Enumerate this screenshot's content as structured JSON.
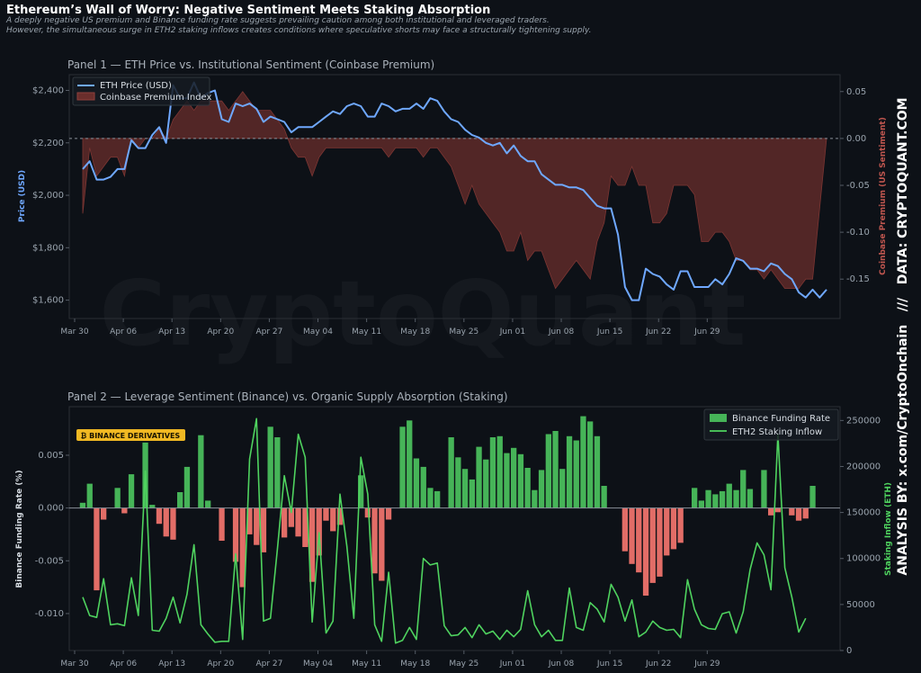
{
  "header": {
    "title": "Ethereum’s Wall of Worry: Negative Sentiment Meets Staking Absorption",
    "subtitle_1": "A deeply negative US premium and Binance funding rate suggests prevailing caution among both institutional and leveraged traders.",
    "subtitle_2": "However, the simultaneous surge in ETH2 staking inflows creates conditions where speculative shorts may face a structurally tightening supply."
  },
  "side_text": {
    "analysis": "ANALYSIS BY: x.com/CryptoOnchain",
    "separator": "///",
    "data": "DATA: CRYPTOQUANT.COM"
  },
  "watermark": "CryptoQuant",
  "colors": {
    "background": "#0d1117",
    "price": "#6fa8ff",
    "premium": "#6a2e2c",
    "funding_pos": "#46b458",
    "funding_neg": "#e26d67",
    "staking": "#4fd35f",
    "badge": "#f0b823"
  },
  "chart_data": [
    {
      "type": "line",
      "title": "Panel 1 — ETH Price vs. Institutional Sentiment (Coinbase Premium)",
      "ylabel": "Price (USD)",
      "y2label": "Coinbase Premium (US Sentiment)",
      "ylim": [
        1530,
        2460
      ],
      "y2lim": [
        -0.192,
        0.068
      ],
      "y_ticks": [
        "$1,600",
        "$1,800",
        "$2,000",
        "$2,200",
        "$2,400"
      ],
      "y2_ticks": [
        "0.05",
        "0.00",
        "-0.05",
        "-0.10",
        "-0.15"
      ],
      "x_ticks": [
        "Mar 30",
        "Apr 06",
        "Apr 13",
        "Apr 20",
        "Apr 27",
        "May 04",
        "May 11",
        "May 18",
        "May 25",
        "Jun 01",
        "Jun 08",
        "Jun 15",
        "Jun 22",
        "Jun 29"
      ],
      "legend": [
        "ETH Price (USD)",
        "Coinbase Premium Index"
      ],
      "legend_position": "top-left",
      "zero_line": 0,
      "x_start": "Mar 31",
      "x_step_days": 1,
      "series": [
        {
          "name": "ETH Price (USD)",
          "axis": "left",
          "values": [
            2100,
            2130,
            2060,
            2060,
            2070,
            2100,
            2100,
            2210,
            2180,
            2180,
            2230,
            2260,
            2200,
            2420,
            2370,
            2370,
            2430,
            2370,
            2390,
            2400,
            2290,
            2280,
            2350,
            2340,
            2350,
            2330,
            2280,
            2300,
            2290,
            2280,
            2240,
            2260,
            2260,
            2260,
            2280,
            2300,
            2320,
            2310,
            2340,
            2350,
            2340,
            2300,
            2300,
            2350,
            2340,
            2320,
            2330,
            2330,
            2350,
            2330,
            2370,
            2360,
            2320,
            2290,
            2280,
            2250,
            2230,
            2220,
            2200,
            2190,
            2200,
            2160,
            2190,
            2150,
            2130,
            2130,
            2080,
            2060,
            2040,
            2040,
            2030,
            2030,
            2020,
            1990,
            1960,
            1950,
            1950,
            1850,
            1650,
            1600,
            1600,
            1720,
            1700,
            1690,
            1660,
            1640,
            1710,
            1710,
            1650,
            1650,
            1650,
            1680,
            1660,
            1700,
            1760,
            1750,
            1720,
            1720,
            1710,
            1740,
            1730,
            1700,
            1680,
            1630,
            1610,
            1640,
            1610,
            1640
          ],
          "_note": "one value per day starting at x_start"
        },
        {
          "name": "Coinbase Premium Index",
          "axis": "right",
          "values": [
            -0.08,
            -0.01,
            -0.04,
            -0.03,
            -0.02,
            -0.02,
            -0.04,
            0.0,
            -0.01,
            0.0,
            0.0,
            0.01,
            0.0,
            0.02,
            0.03,
            0.04,
            0.03,
            0.04,
            0.04,
            0.04,
            0.04,
            0.03,
            0.04,
            0.05,
            0.04,
            0.03,
            0.03,
            0.03,
            0.02,
            0.01,
            -0.01,
            -0.02,
            -0.02,
            -0.04,
            -0.02,
            -0.01,
            -0.01,
            -0.01,
            -0.01,
            -0.01,
            -0.01,
            -0.01,
            -0.01,
            -0.01,
            -0.02,
            -0.01,
            -0.01,
            -0.01,
            -0.01,
            -0.02,
            -0.01,
            -0.01,
            -0.02,
            -0.03,
            -0.05,
            -0.07,
            -0.05,
            -0.07,
            -0.08,
            -0.09,
            -0.1,
            -0.12,
            -0.12,
            -0.1,
            -0.13,
            -0.12,
            -0.12,
            -0.14,
            -0.16,
            -0.15,
            -0.14,
            -0.13,
            -0.14,
            -0.15,
            -0.11,
            -0.09,
            -0.04,
            -0.05,
            -0.05,
            -0.03,
            -0.05,
            -0.05,
            -0.09,
            -0.09,
            -0.08,
            -0.05,
            -0.05,
            -0.05,
            -0.06,
            -0.11,
            -0.11,
            -0.1,
            -0.1,
            -0.11,
            -0.13,
            -0.13,
            -0.14,
            -0.14,
            -0.15,
            -0.14,
            -0.15,
            -0.16,
            -0.16,
            -0.16,
            -0.15,
            -0.15
          ],
          "_note": "one value per day starting at x_start"
        }
      ]
    },
    {
      "type": "bar",
      "title": "Panel 2 — Leverage Sentiment (Binance) vs. Organic Supply Absorption (Staking)",
      "ylabel": "Binance Funding Rate (%)",
      "y2label": "Staking Inflow (ETH)",
      "ylim": [
        -0.0135,
        0.0096
      ],
      "y2lim": [
        0,
        265000
      ],
      "y_ticks": [
        "0.005",
        "0.000",
        "-0.005",
        "-0.010"
      ],
      "y2_ticks": [
        "0",
        "50000",
        "100000",
        "150000",
        "200000",
        "250000"
      ],
      "x_ticks": [
        "Mar 30",
        "Apr 06",
        "Apr 13",
        "Apr 20",
        "Apr 27",
        "May 04",
        "May 11",
        "May 18",
        "May 25",
        "Jun 01",
        "Jun 08",
        "Jun 15",
        "Jun 22",
        "Jun 29"
      ],
      "legend": [
        "Binance Funding Rate",
        "ETH2 Staking Inflow"
      ],
      "legend_position": "top-right",
      "badge": "₿ BINANCE DERIVATIVES",
      "x_start": "Mar 31",
      "x_step_days": 1,
      "series": [
        {
          "name": "Binance Funding Rate",
          "axis": "left",
          "kind": "bar",
          "values": [
            0.0005,
            0.0023,
            -0.0078,
            -0.0011,
            0.0,
            0.0019,
            -0.0005,
            0.0032,
            0.0,
            0.0062,
            0.0003,
            -0.0015,
            -0.0027,
            -0.003,
            0.0015,
            0.0039,
            0.0,
            0.0069,
            0.0007,
            0.0,
            -0.0031,
            0.0,
            -0.0051,
            -0.0075,
            -0.0025,
            -0.0035,
            -0.0042,
            0.0077,
            0.0067,
            -0.0028,
            -0.0018,
            -0.0027,
            -0.0037,
            -0.007,
            -0.0045,
            -0.0012,
            -0.0022,
            -0.0016,
            0.0,
            0.0,
            0.0031,
            -0.0009,
            -0.0062,
            -0.0069,
            -0.0011,
            0.0,
            0.0077,
            0.0083,
            0.0047,
            0.0039,
            0.0019,
            0.0016,
            0.0,
            0.0067,
            0.0048,
            0.0037,
            0.0027,
            0.0058,
            0.0046,
            0.0067,
            0.0068,
            0.0052,
            0.0057,
            0.0051,
            0.0038,
            0.0017,
            0.0036,
            0.007,
            0.0073,
            0.0037,
            0.0068,
            0.0064,
            0.0087,
            0.0082,
            0.0068,
            0.0021,
            0.0,
            0.0,
            -0.0041,
            -0.0053,
            -0.0061,
            -0.0083,
            -0.0071,
            -0.0065,
            -0.0045,
            -0.0039,
            -0.0033,
            0.0,
            0.0019,
            0.0007,
            0.0017,
            0.0013,
            0.0016,
            0.0023,
            0.0017,
            0.0036,
            0.0018,
            0.0,
            0.0036,
            -0.0007,
            -0.0004,
            0.0,
            -0.0007,
            -0.0012,
            -0.001,
            0.0021
          ],
          "_note": "one value per day starting at x_start"
        },
        {
          "name": "ETH2 Staking Inflow",
          "axis": "right",
          "kind": "line",
          "values": [
            58000,
            38000,
            36000,
            78000,
            28000,
            29000,
            27000,
            79000,
            38000,
            195000,
            22000,
            21000,
            35000,
            58000,
            30000,
            61000,
            115000,
            28000,
            18000,
            9000,
            10000,
            10000,
            105000,
            12000,
            208000,
            252000,
            32000,
            35000,
            110000,
            190000,
            150000,
            235000,
            210000,
            31000,
            128000,
            19000,
            32000,
            170000,
            113000,
            35000,
            210000,
            170000,
            28000,
            10000,
            85000,
            8000,
            11000,
            25000,
            12000,
            100000,
            93000,
            95000,
            27000,
            16000,
            17000,
            25000,
            14000,
            28000,
            18000,
            21000,
            12000,
            22000,
            15000,
            23000,
            65000,
            28000,
            15000,
            22000,
            11000,
            11000,
            68000,
            25000,
            22000,
            52000,
            45000,
            31000,
            72000,
            58000,
            32000,
            55000,
            15000,
            20000,
            32000,
            25000,
            22000,
            23000,
            14000,
            77000,
            45000,
            28000,
            24000,
            23000,
            40000,
            42000,
            19000,
            42000,
            88000,
            117000,
            104000,
            66000,
            235000,
            90000,
            58000,
            20000,
            35000
          ],
          "_note": "one value per day starting at x_start"
        }
      ]
    }
  ]
}
